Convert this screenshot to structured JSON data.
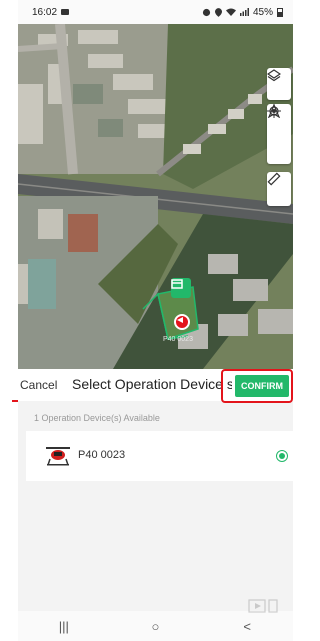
{
  "status_bar": {
    "time": "16:02",
    "battery": "45%"
  },
  "map": {
    "device_label": "P40 0023"
  },
  "sheet": {
    "cancel_label": "Cancel",
    "title": "Select Operation Device s",
    "confirm_label": "CONFIRM",
    "available_text": "1 Operation Device(s) Available",
    "devices": [
      {
        "name": "P40 0023",
        "selected": true
      }
    ]
  },
  "nav": {
    "recents": "|||",
    "home": "○",
    "back": "<"
  },
  "colors": {
    "accent": "#22b86a",
    "highlight": "#e3141b"
  }
}
